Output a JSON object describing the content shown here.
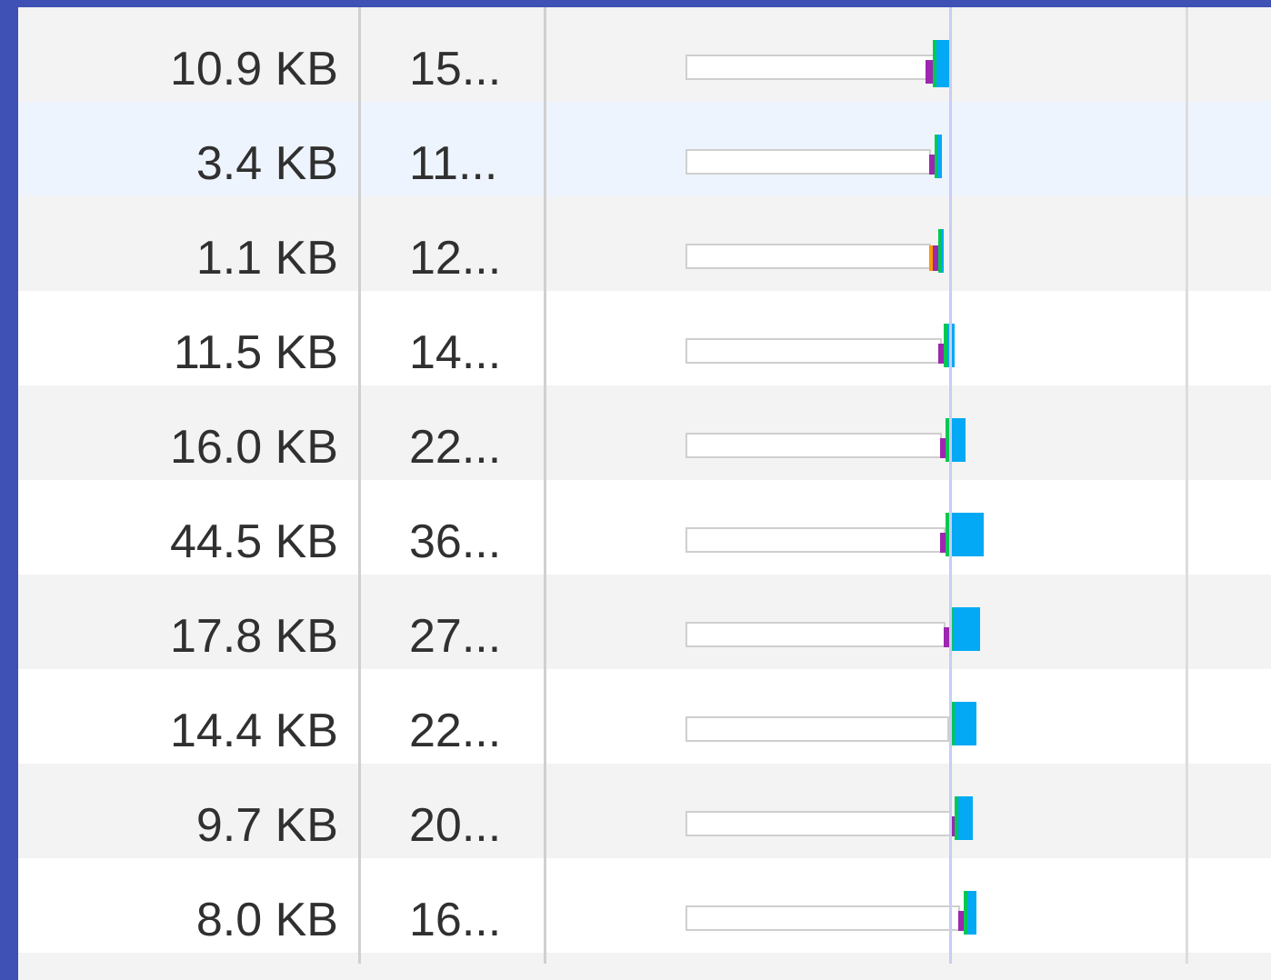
{
  "colors": {
    "page_border": "#3f51b5",
    "queue_fill": "#ffffff",
    "stalled": "#9c27b0",
    "connect": "#ff9800",
    "waiting": "#00c853",
    "download": "#03a9f4",
    "marker_line": "#c9ccf4"
  },
  "requests": [
    {
      "size": "10.9 KB",
      "time": "15...",
      "style": "shade"
    },
    {
      "size": "3.4 KB",
      "time": "11...",
      "style": "selected"
    },
    {
      "size": "1.1 KB",
      "time": "12...",
      "style": "shade"
    },
    {
      "size": "11.5 KB",
      "time": "14...",
      "style": "plain"
    },
    {
      "size": "16.0 KB",
      "time": "22...",
      "style": "shade"
    },
    {
      "size": "44.5 KB",
      "time": "36...",
      "style": "plain"
    },
    {
      "size": "17.8 KB",
      "time": "27...",
      "style": "shade"
    },
    {
      "size": "14.4 KB",
      "time": "22...",
      "style": "plain"
    },
    {
      "size": "9.7 KB",
      "time": "20...",
      "style": "shade"
    },
    {
      "size": "8.0 KB",
      "time": "16...",
      "style": "plain"
    }
  ]
}
